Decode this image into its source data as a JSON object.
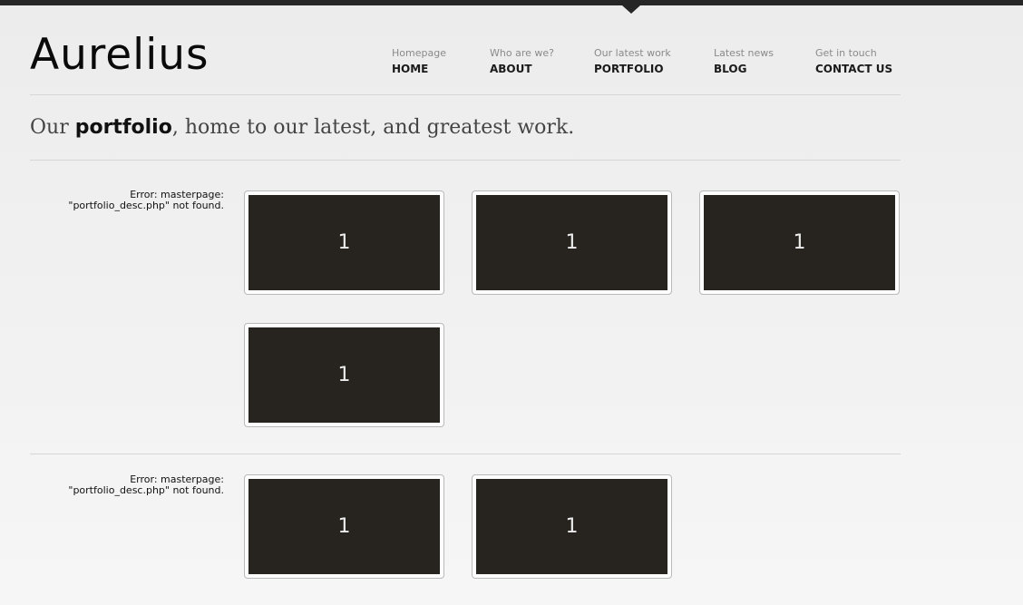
{
  "site": {
    "logo": "Aurelius"
  },
  "nav": [
    {
      "sub": "Homepage",
      "label": "HOME"
    },
    {
      "sub": "Who are we?",
      "label": "ABOUT"
    },
    {
      "sub": "Our latest work",
      "label": "PORTFOLIO"
    },
    {
      "sub": "Latest news",
      "label": "BLOG"
    },
    {
      "sub": "Get in touch",
      "label": "CONTACT US"
    }
  ],
  "tagline": {
    "prefix": "Our ",
    "bold": "portfolio",
    "suffix": ", home to our latest, and greatest work."
  },
  "sections": [
    {
      "error_line1": "Error: masterpage:",
      "error_line2": "\"portfolio_desc.php\" not found.",
      "items": [
        "1",
        "1",
        "1",
        "1"
      ]
    },
    {
      "error_line1": "Error: masterpage:",
      "error_line2": "\"portfolio_desc.php\" not found.",
      "items": [
        "1",
        "1"
      ]
    }
  ],
  "colors": {
    "topbar": "#262626",
    "thumb_fill": "#27231e",
    "rule": "#d6d6d6"
  }
}
